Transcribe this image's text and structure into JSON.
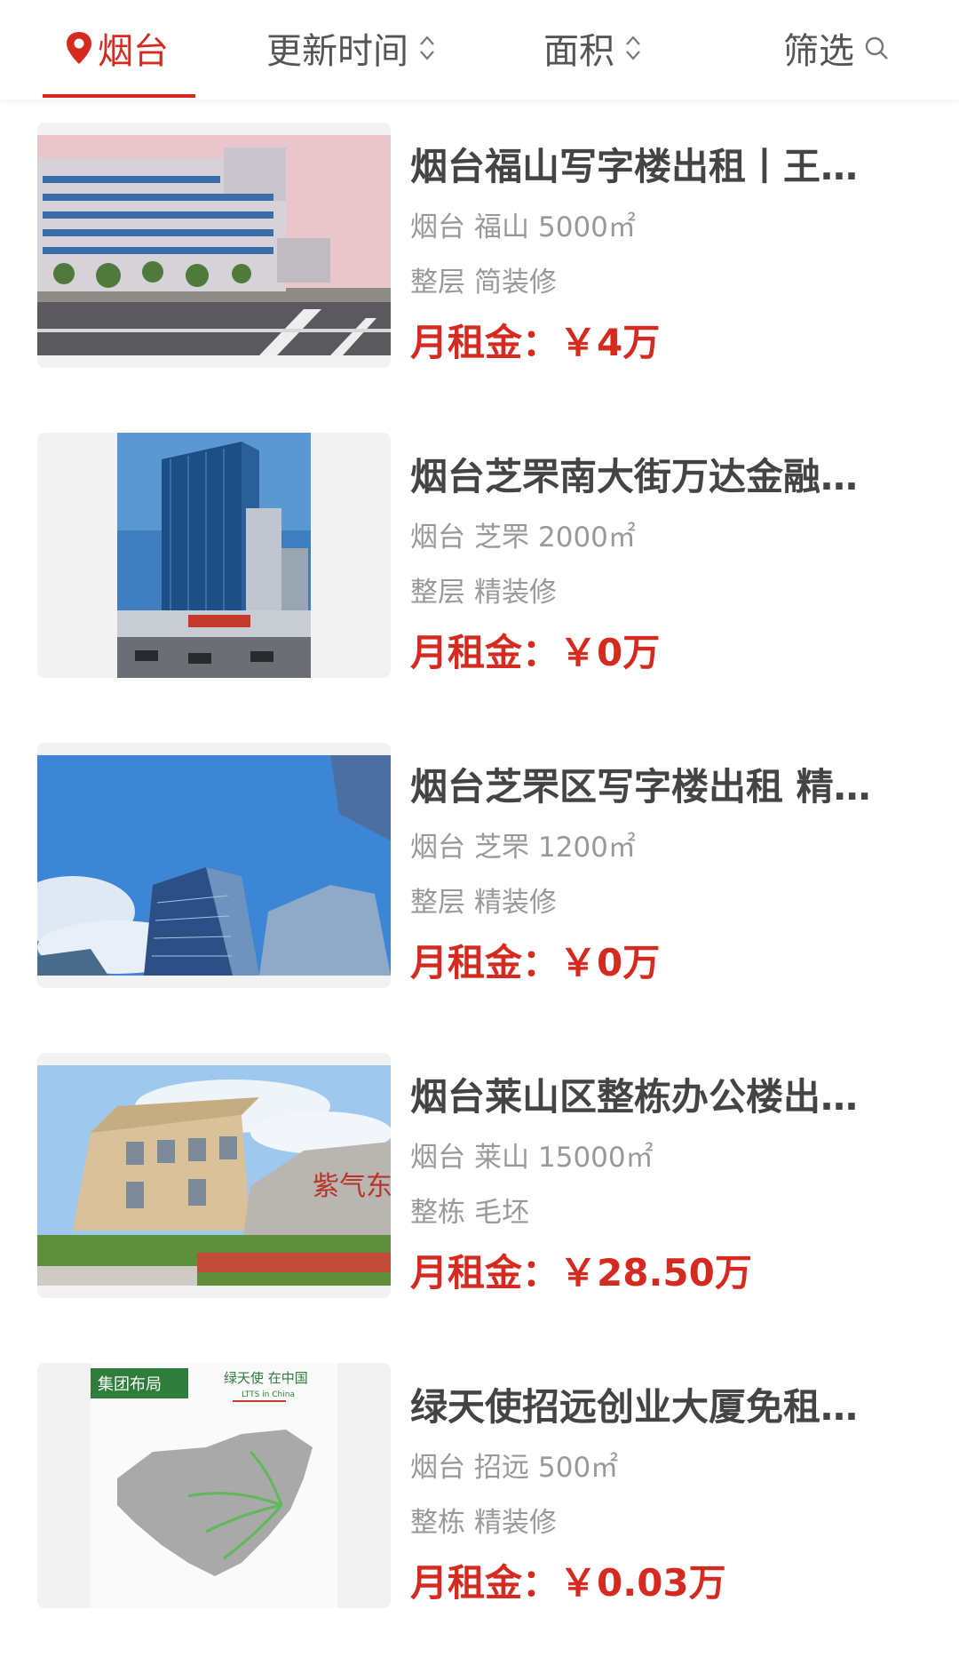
{
  "filter_bar": {
    "city": "烟台",
    "sort_time": "更新时间",
    "sort_area": "面积",
    "filter": "筛选",
    "accent_color": "#d42a1f"
  },
  "listings": [
    {
      "title": "烟台福山写字楼出租丨王…",
      "city": "烟台",
      "district": "福山",
      "area": "5000㎡",
      "floor_type": "整层",
      "decoration": "简装修",
      "rent_label": "月租金：",
      "rent_value": "￥4万"
    },
    {
      "title": "烟台芝罘南大街万达金融…",
      "city": "烟台",
      "district": "芝罘",
      "area": "2000㎡",
      "floor_type": "整层",
      "decoration": "精装修",
      "rent_label": "月租金：",
      "rent_value": "￥0万"
    },
    {
      "title": "烟台芝罘区写字楼出租 精…",
      "city": "烟台",
      "district": "芝罘",
      "area": "1200㎡",
      "floor_type": "整层",
      "decoration": "精装修",
      "rent_label": "月租金：",
      "rent_value": "￥0万"
    },
    {
      "title": "烟台莱山区整栋办公楼出…",
      "city": "烟台",
      "district": "莱山",
      "area": "15000㎡",
      "floor_type": "整栋",
      "decoration": "毛坯",
      "rent_label": "月租金：",
      "rent_value": "￥28.50万"
    },
    {
      "title": "绿天使招远创业大厦免租…",
      "city": "烟台",
      "district": "招远",
      "area": "500㎡",
      "floor_type": "整栋",
      "decoration": "精装修",
      "rent_label": "月租金：",
      "rent_value": "￥0.03万"
    }
  ],
  "thumb_texts": {
    "map_left": "集团布局",
    "map_right": "绿天使  在中国",
    "map_right_sub": "LTTS in China",
    "stone_text": "紫气东来"
  }
}
